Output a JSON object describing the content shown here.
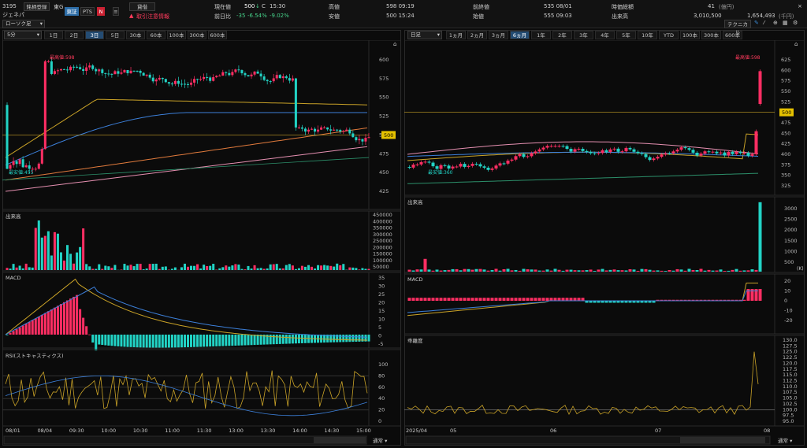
{
  "header": {
    "code": "3195",
    "name": "ジェネパ",
    "reg_button": "銘柄登録",
    "market": "東G",
    "tse": "東証",
    "pts": "PTS",
    "notice_button": "貸借",
    "alert": "取引注意情報",
    "price_label": "現在値",
    "price": "500",
    "price_unit": "↓",
    "price_flag": "C",
    "price_time": "15:30",
    "prev_label": "前日比",
    "change": "-35",
    "change_pct": "-6.54%",
    "change_pct2": "-9.02%",
    "high_label": "高値",
    "high": "598 09:19",
    "low_label": "安値",
    "low": "500 15:24",
    "prevclose_label": "前終値",
    "prevclose": "535 08/01",
    "open_label": "始値",
    "open": "555 09:03",
    "mcap_label": "時価総額",
    "mcap": "41",
    "mcap_unit": "(億円)",
    "volume_label": "出来高",
    "volume": "3,010,500",
    "value": "1,654,493",
    "value_unit": "(千円)"
  },
  "left": {
    "chart_type": "ローソク足",
    "interval": "5分",
    "ranges": [
      "1日",
      "2日",
      "3日",
      "5日",
      "30本",
      "60本",
      "100本",
      "300本",
      "600本"
    ],
    "active_range": "3日",
    "price_ticks": [
      "600",
      "575",
      "550",
      "525",
      "500",
      "475",
      "450",
      "425"
    ],
    "current_price_tag": "500",
    "high_label": "最高値:598",
    "low_label": "最安値:455",
    "vol_title": "出来高",
    "vol_ticks": [
      "450000",
      "400000",
      "350000",
      "300000",
      "250000",
      "200000",
      "150000",
      "100000",
      "50000"
    ],
    "macd_title": "MACD",
    "macd_ticks": [
      "35",
      "30",
      "25",
      "20",
      "15",
      "10",
      "5",
      "0",
      "-5"
    ],
    "rsi_title": "RSI(ストキャスティクス)",
    "rsi_ticks": [
      "100",
      "80",
      "60",
      "40",
      "20",
      "0"
    ],
    "time_labels": [
      "08/01",
      "08/04",
      "09:30",
      "10:00",
      "10:30",
      "11:00",
      "11:30",
      "13:00",
      "13:30",
      "14:00",
      "14:30",
      "15:00"
    ],
    "mode": "通常"
  },
  "right": {
    "chart_type": "日足",
    "ranges": [
      "1ヵ月",
      "2ヵ月",
      "3ヵ月",
      "6ヵ月",
      "1年",
      "2年",
      "3年",
      "4年",
      "5年",
      "10年",
      "YTD",
      "100本",
      "300本",
      "600本"
    ],
    "active_range": "6ヵ月",
    "tech_button": "テクニカル",
    "price_ticks": [
      "625",
      "600",
      "575",
      "550",
      "525",
      "500",
      "475",
      "450",
      "425",
      "400",
      "375",
      "350",
      "325"
    ],
    "current_price_tag": "500",
    "high_label": "最高値:598",
    "low_label": "最安値:360",
    "vol_title": "出来高",
    "vol_ticks": [
      "3000",
      "2500",
      "2000",
      "1500",
      "1000",
      "500"
    ],
    "vol_unit": "(K)",
    "macd_title": "MACD",
    "macd_ticks": [
      "20",
      "10",
      "0",
      "-10",
      "-20"
    ],
    "dev_title": "乖離度",
    "dev_ticks": [
      "130.0",
      "127.5",
      "125.0",
      "122.5",
      "120.0",
      "117.5",
      "115.0",
      "112.5",
      "110.0",
      "107.5",
      "105.0",
      "102.5",
      "100.0",
      "97.5",
      "95.0"
    ],
    "time_labels": [
      "2025/04",
      "05",
      "06",
      "07",
      "08"
    ],
    "mode": "通常"
  },
  "colors": {
    "up": "#ff2e63",
    "down": "#22d3c5",
    "bg": "#0b0b0b",
    "grid": "#2a2a2a",
    "accent": "#2e6ea8"
  }
}
